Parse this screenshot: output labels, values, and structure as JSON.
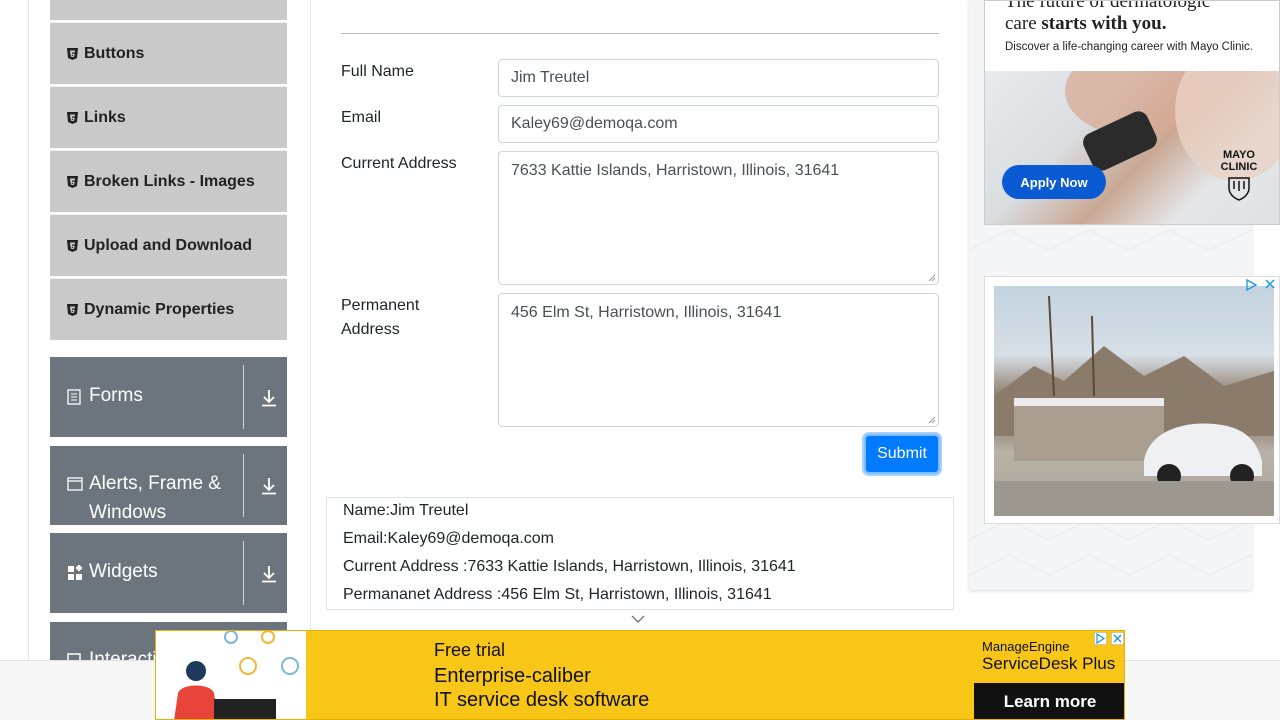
{
  "sidebar": {
    "elements_items": [
      {
        "label": "Buttons"
      },
      {
        "label": "Links"
      },
      {
        "label": "Broken Links - Images"
      },
      {
        "label": "Upload and Download"
      },
      {
        "label": "Dynamic Properties"
      }
    ],
    "groups": [
      {
        "label": "Forms",
        "icon": "form-icon"
      },
      {
        "label": "Alerts, Frame &",
        "label2": "Windows",
        "icon": "window-icon"
      },
      {
        "label": "Widgets",
        "icon": "widgets-icon"
      },
      {
        "label": "Interacti",
        "icon": "interactions-icon"
      }
    ]
  },
  "form": {
    "labels": {
      "full_name": "Full Name",
      "email": "Email",
      "current_address": "Current Address",
      "permanent_address_1": "Permanent",
      "permanent_address_2": "Address"
    },
    "values": {
      "full_name": "Jim Treutel",
      "email": "Kaley69@demoqa.com",
      "current_address": "7633 Kattie Islands, Harristown, Illinois, 31641",
      "permanent_address": "456 Elm St, Harristown, Illinois, 31641"
    },
    "submit_label": "Submit"
  },
  "output": {
    "name": "Name:Jim Treutel",
    "email": "Email:Kaley69@demoqa.com",
    "current_address": "Current Address :7633 Kattie Islands, Harristown, Illinois, 31641",
    "permanent_address": "Permananet Address :456 Elm St, Harristown, Illinois, 31641"
  },
  "ads": {
    "ad1": {
      "headline_1": "The future of dermatologic",
      "headline_2a": "care ",
      "headline_2b": "starts with you.",
      "subtext": "Discover a life-changing career with Mayo Clinic.",
      "button": "Apply Now",
      "logo_1": "MAYO",
      "logo_2": "CLINIC"
    },
    "banner": {
      "line1": "Free trial",
      "line2": "Enterprise-caliber",
      "line3": "IT service desk software",
      "brand1": "ManageEngine",
      "brand2": "ServiceDesk Plus",
      "cta": "Learn more"
    }
  },
  "colors": {
    "accent": "#007bff",
    "sidebar_item_bg": "#c9c9c9",
    "group_bg": "#6c757d",
    "banner_bg": "#f8c617"
  }
}
